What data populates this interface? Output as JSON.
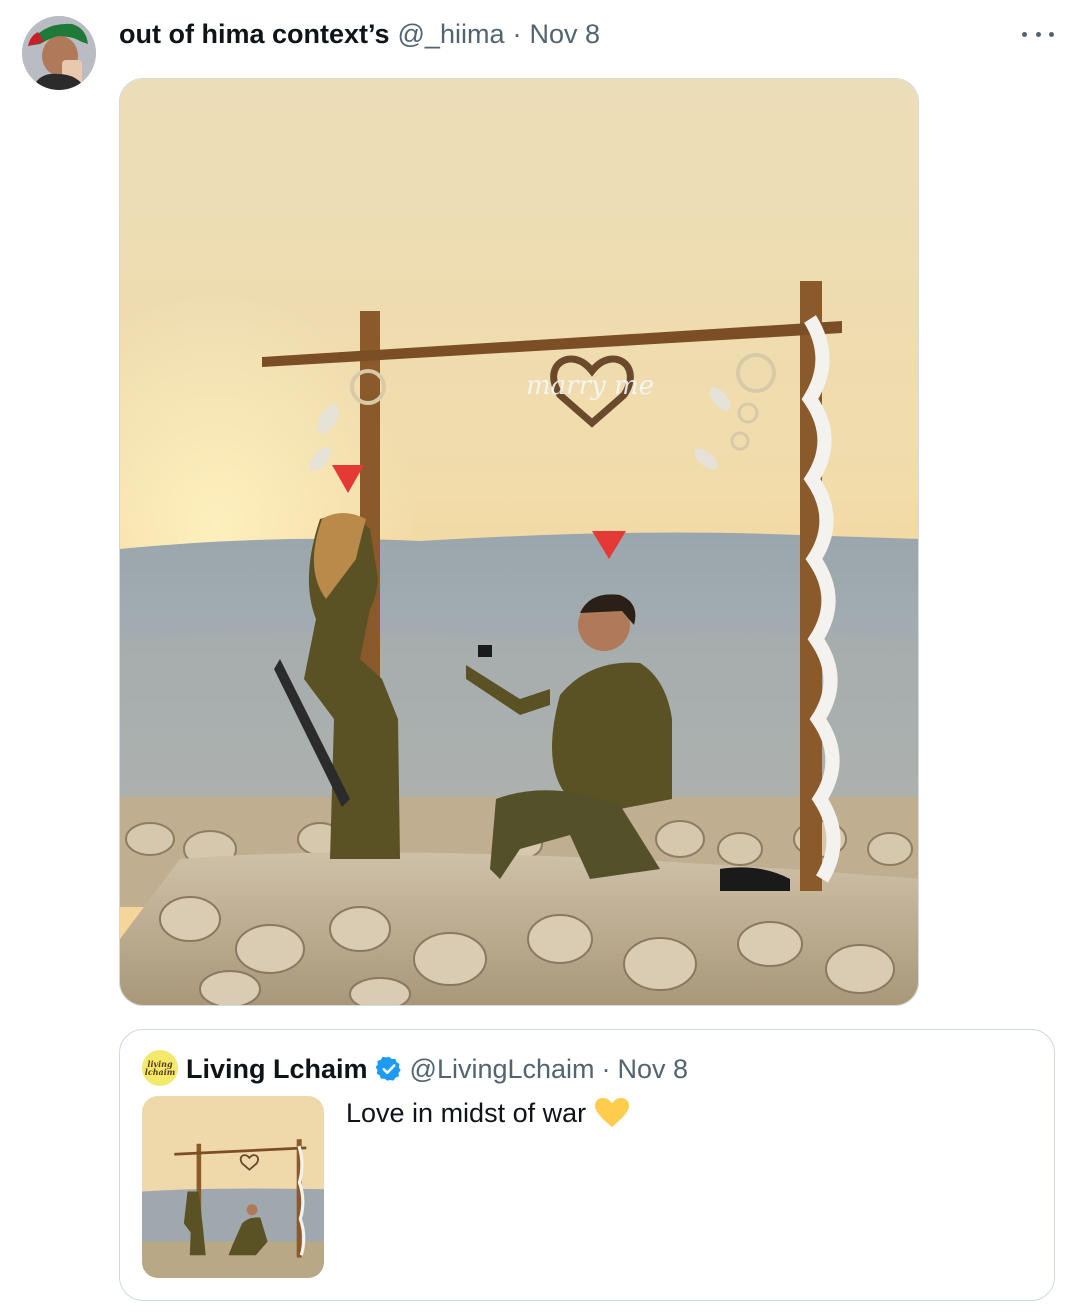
{
  "tweet": {
    "author_name": "out of hima context’s",
    "author_handle": "@_hiima",
    "separator": "·",
    "timestamp": "Nov 8",
    "avatar_icon": "profile-avatar",
    "more_icon": "more-options-icon",
    "media": {
      "description_icon": "photo-image",
      "sign_text": "marry me"
    }
  },
  "quote": {
    "author_name": "Living Lchaim",
    "author_handle": "@LivingLchaim",
    "separator": "·",
    "timestamp": "Nov 8",
    "avatar_text": "living lchaim",
    "verified_icon": "verified-badge-icon",
    "verified_color": "#1d9bf0",
    "text": "Love in midst of war",
    "emoji_icon": "yellow-heart-icon",
    "emoji_color": "#ffcc4d"
  }
}
